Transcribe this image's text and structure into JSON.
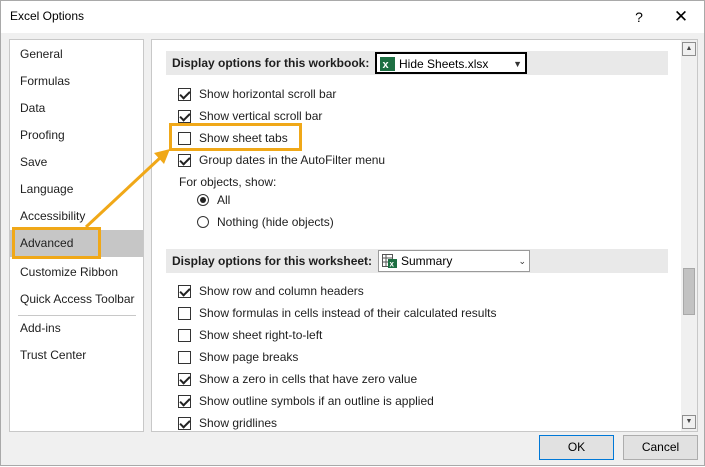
{
  "window": {
    "title": "Excel Options",
    "help_glyph": "?",
    "close_glyph": "✕"
  },
  "sidebar": {
    "items": [
      {
        "label": "General"
      },
      {
        "label": "Formulas"
      },
      {
        "label": "Data"
      },
      {
        "label": "Proofing"
      },
      {
        "label": "Save"
      },
      {
        "label": "Language"
      },
      {
        "label": "Accessibility"
      },
      {
        "label": "Advanced",
        "selected": true
      },
      {
        "label": "Customize Ribbon"
      },
      {
        "label": "Quick Access Toolbar"
      },
      {
        "label": "Add-ins"
      },
      {
        "label": "Trust Center"
      }
    ]
  },
  "workbook_section": {
    "header": "Display options for this workbook:",
    "combo_value": "Hide Sheets.xlsx",
    "options": [
      {
        "label": "Show horizontal scroll bar",
        "checked": true
      },
      {
        "label": "Show vertical scroll bar",
        "checked": true
      },
      {
        "label": "Show sheet tabs",
        "checked": false
      },
      {
        "label": "Group dates in the AutoFilter menu",
        "checked": true
      }
    ],
    "objects_label": "For objects, show:",
    "radio_options": [
      {
        "label": "All",
        "selected": true
      },
      {
        "label": "Nothing (hide objects)",
        "selected": false
      }
    ]
  },
  "worksheet_section": {
    "header": "Display options for this worksheet:",
    "combo_value": "Summary",
    "options": [
      {
        "label": "Show row and column headers",
        "checked": true
      },
      {
        "label": "Show formulas in cells instead of their calculated results",
        "checked": false
      },
      {
        "label": "Show sheet right-to-left",
        "checked": false
      },
      {
        "label": "Show page breaks",
        "checked": false
      },
      {
        "label": "Show a zero in cells that have zero value",
        "checked": true
      },
      {
        "label": "Show outline symbols if an outline is applied",
        "checked": true
      },
      {
        "label": "Show gridlines",
        "checked": true
      }
    ]
  },
  "footer": {
    "ok_label": "OK",
    "cancel_label": "Cancel"
  },
  "colors": {
    "highlight": "#f0a818",
    "excel_green": "#1d6f42"
  }
}
